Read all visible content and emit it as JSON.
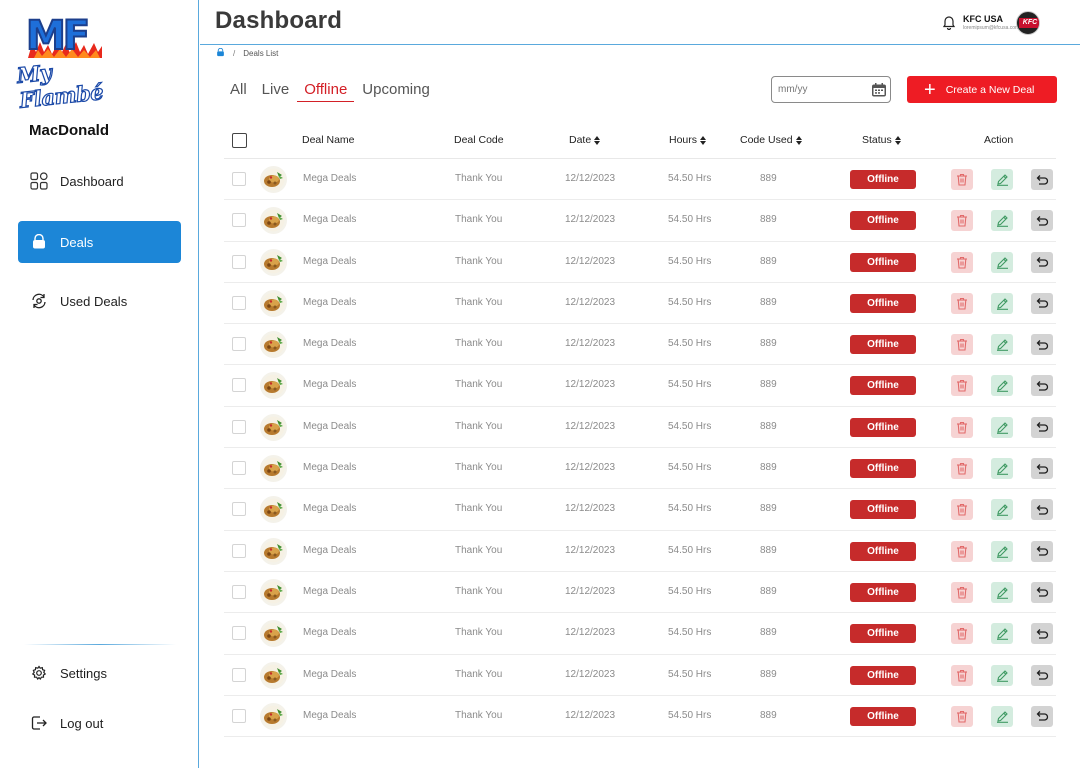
{
  "brand": {
    "logo_initials": "MF",
    "logo_script": "My Flambé"
  },
  "sidebar": {
    "store_name": "MacDonald",
    "items": [
      {
        "label": "Dashboard",
        "icon": "grid-icon"
      },
      {
        "label": "Deals",
        "icon": "bag-icon",
        "active": true
      },
      {
        "label": "Used Deals",
        "icon": "refresh-icon"
      }
    ],
    "bottom_items": [
      {
        "label": "Settings",
        "icon": "gear-icon"
      },
      {
        "label": "Log out",
        "icon": "logout-icon"
      }
    ]
  },
  "header": {
    "title": "Dashboard",
    "account_name": "KFC USA",
    "account_sub": "loremipsum@kfcusa.com",
    "avatar_text": "KFC"
  },
  "breadcrumb": {
    "current": "Deals List"
  },
  "tabs": [
    {
      "label": "All"
    },
    {
      "label": "Live"
    },
    {
      "label": "Offline",
      "active": true
    },
    {
      "label": "Upcoming"
    }
  ],
  "filter": {
    "date_placeholder": "mm/yy"
  },
  "create_button": {
    "label": "Create a New Deal"
  },
  "table": {
    "columns": {
      "deal_name": "Deal Name",
      "deal_code": "Deal Code",
      "date": "Date",
      "hours": "Hours",
      "code_used": "Code Used",
      "status": "Status",
      "action": "Action"
    },
    "rows": [
      {
        "name": "Mega Deals",
        "code": "Thank You",
        "date": "12/12/2023",
        "hours": "54.50 Hrs",
        "used": "889",
        "status": "Offline"
      },
      {
        "name": "Mega Deals",
        "code": "Thank You",
        "date": "12/12/2023",
        "hours": "54.50 Hrs",
        "used": "889",
        "status": "Offline"
      },
      {
        "name": "Mega Deals",
        "code": "Thank You",
        "date": "12/12/2023",
        "hours": "54.50 Hrs",
        "used": "889",
        "status": "Offline"
      },
      {
        "name": "Mega Deals",
        "code": "Thank You",
        "date": "12/12/2023",
        "hours": "54.50 Hrs",
        "used": "889",
        "status": "Offline"
      },
      {
        "name": "Mega Deals",
        "code": "Thank You",
        "date": "12/12/2023",
        "hours": "54.50 Hrs",
        "used": "889",
        "status": "Offline"
      },
      {
        "name": "Mega Deals",
        "code": "Thank You",
        "date": "12/12/2023",
        "hours": "54.50 Hrs",
        "used": "889",
        "status": "Offline"
      },
      {
        "name": "Mega Deals",
        "code": "Thank You",
        "date": "12/12/2023",
        "hours": "54.50 Hrs",
        "used": "889",
        "status": "Offline"
      },
      {
        "name": "Mega Deals",
        "code": "Thank You",
        "date": "12/12/2023",
        "hours": "54.50 Hrs",
        "used": "889",
        "status": "Offline"
      },
      {
        "name": "Mega Deals",
        "code": "Thank You",
        "date": "12/12/2023",
        "hours": "54.50 Hrs",
        "used": "889",
        "status": "Offline"
      },
      {
        "name": "Mega Deals",
        "code": "Thank You",
        "date": "12/12/2023",
        "hours": "54.50 Hrs",
        "used": "889",
        "status": "Offline"
      },
      {
        "name": "Mega Deals",
        "code": "Thank You",
        "date": "12/12/2023",
        "hours": "54.50 Hrs",
        "used": "889",
        "status": "Offline"
      },
      {
        "name": "Mega Deals",
        "code": "Thank You",
        "date": "12/12/2023",
        "hours": "54.50 Hrs",
        "used": "889",
        "status": "Offline"
      },
      {
        "name": "Mega Deals",
        "code": "Thank You",
        "date": "12/12/2023",
        "hours": "54.50 Hrs",
        "used": "889",
        "status": "Offline"
      },
      {
        "name": "Mega Deals",
        "code": "Thank You",
        "date": "12/12/2023",
        "hours": "54.50 Hrs",
        "used": "889",
        "status": "Offline"
      }
    ]
  },
  "colors": {
    "accent_blue": "#1c86d7",
    "danger_red": "#ee1c24",
    "status_offline": "#c62b2b",
    "divider_blue": "#5aa9dd"
  }
}
